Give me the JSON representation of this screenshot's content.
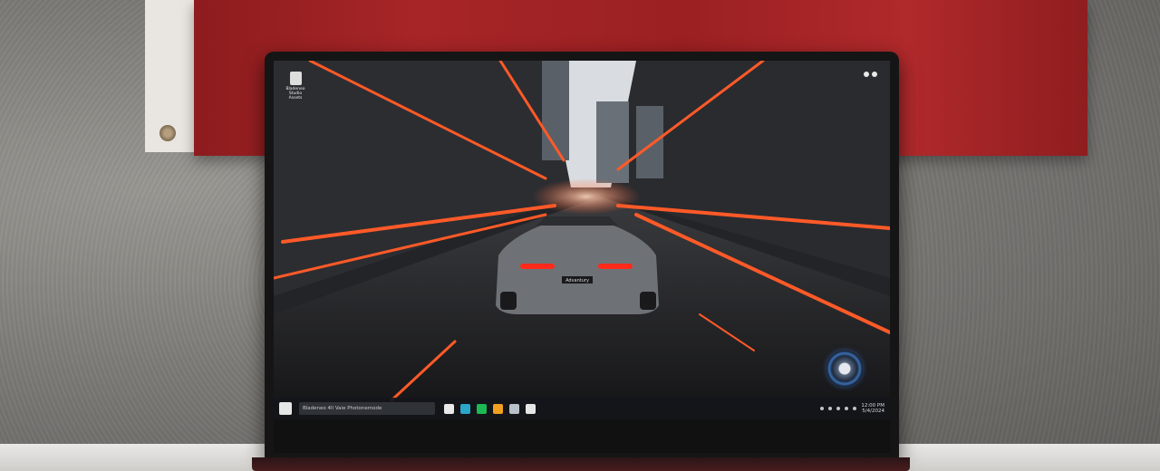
{
  "scene": {
    "colors": {
      "flag_red": "#a72527",
      "laptop_body": "#151515",
      "streak_orange": "#ff5a28"
    }
  },
  "desktop": {
    "top_left_icon_label": "Bladeneo",
    "top_left_icon_caption": "Studio Assets",
    "car_plate": "Advantury"
  },
  "taskbar": {
    "search_text": "Bladeneo 4ll Vaie Photonemode",
    "clock_time": "12:00 PM",
    "clock_date": "5/4/2024",
    "apps": [
      {
        "name": "file-explorer-icon",
        "color": "#e9e9ea"
      },
      {
        "name": "edge-icon",
        "color": "#2aa6c8"
      },
      {
        "name": "spotify-icon",
        "color": "#1db954"
      },
      {
        "name": "store-icon",
        "color": "#f0a020"
      },
      {
        "name": "mail-icon",
        "color": "#b9c0ca"
      },
      {
        "name": "chrome-icon",
        "color": "#e5e5e5"
      }
    ]
  }
}
